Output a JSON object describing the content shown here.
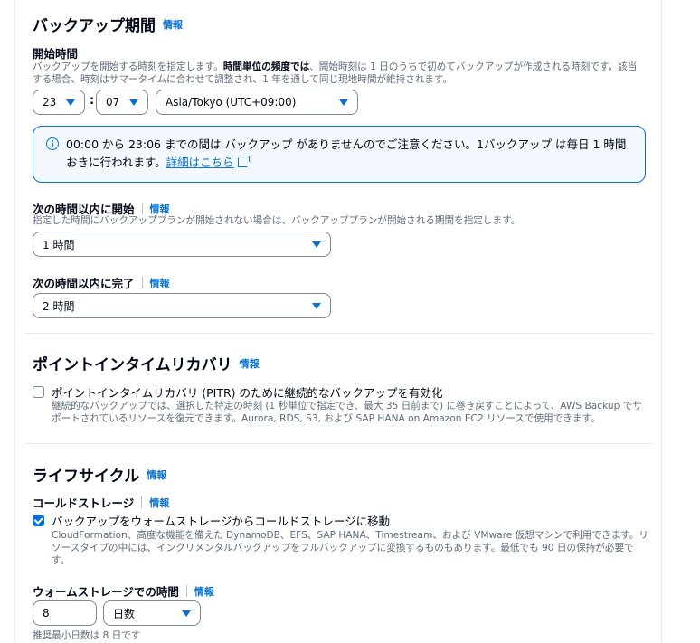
{
  "backup_window": {
    "title": "バックアップ期間",
    "info": "情報",
    "start_time": {
      "label": "開始時間",
      "desc_1": "バックアップを開始する時刻を指定します。",
      "desc_bold": "時間単位の頻度では",
      "desc_2": "、開始時刻は 1 日のうちで初めてバックアップが作成される時刻です。該当する場合、時刻はサマータイムに合わせて調整され、1 年を通して同じ現地時間が維持されます。",
      "hour": "23",
      "separator": ":",
      "minute": "07",
      "timezone": "Asia/Tokyo (UTC+09:00)"
    },
    "alert": {
      "text": "00:00 から 23:06 までの間は バックアップ がありませんのでご注意ください。1バックアップ は毎日 1 時間おきに行われます。",
      "link": "詳細はこちら"
    },
    "start_within": {
      "label": "次の時間以内に開始",
      "info": "情報",
      "desc": "指定した時間にバックアッププランが開始されない場合は、バックアッププランが開始される期間を指定します。",
      "value": "1 時間"
    },
    "complete_within": {
      "label": "次の時間以内に完了",
      "info": "情報",
      "value": "2 時間"
    }
  },
  "pitr": {
    "title": "ポイントインタイムリカバリ",
    "info": "情報",
    "checkbox_label": "ポイントインタイムリカバリ (PITR) のために継続的なバックアップを有効化",
    "checked": false,
    "desc": "継続的なバックアップでは、選択した特定の時刻 (1 秒単位で指定でき、最大 35 日前まで) に巻き戻すことによって、AWS Backup でサポートされているリソースを復元できます。Aurora, RDS, S3, および SAP HANA on Amazon EC2 リソースで使用できます。"
  },
  "lifecycle": {
    "title": "ライフサイクル",
    "info": "情報",
    "cold_storage": {
      "label": "コールドストレージ",
      "info": "情報",
      "checkbox_label": "バックアップをウォームストレージからコールドストレージに移動",
      "checked": true,
      "desc": "CloudFormation、高度な機能を備えた DynamoDB、EFS、SAP HANA、Timestream、および VMware 仮想マシンで利用できます。リソースタイプの中には、インクリメンタルバックアップをフルバックアップに変換するものもあります。最低でも 90 日の保持が必要です。"
    },
    "warm_time": {
      "label": "ウォームストレージでの時間",
      "info": "情報",
      "value": "8",
      "unit": "日数",
      "hint": "推奨最小日数は 8 日です"
    }
  },
  "colors": {
    "accent": "#0972d3",
    "alert_bg": "#f2f8fd",
    "text": "#000716",
    "secondary": "#5f6b7a"
  }
}
